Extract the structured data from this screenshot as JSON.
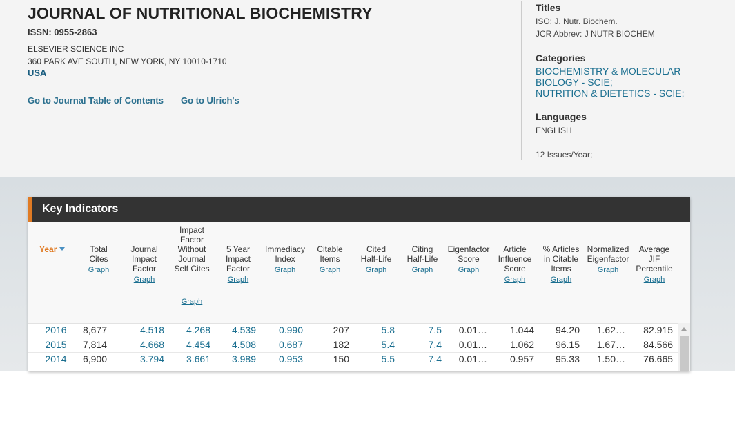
{
  "journal": {
    "title": "JOURNAL OF NUTRITIONAL BIOCHEMISTRY",
    "issn": "ISSN: 0955-2863",
    "publisher": "ELSEVIER SCIENCE INC",
    "address": "360 PARK AVE SOUTH, NEW YORK, NY 10010-1710",
    "country": "USA",
    "links": [
      "Go to Journal Table of Contents",
      "Go to Ulrich's"
    ]
  },
  "sidebar": {
    "titles_heading": "Titles",
    "iso": "ISO: J. Nutr. Biochem.",
    "jcr_abbrev": "JCR Abbrev: J NUTR BIOCHEM",
    "categories_heading": "Categories",
    "categories": [
      "BIOCHEMISTRY & MOLECULAR BIOLOGY - SCIE;",
      "NUTRITION & DIETETICS - SCIE;"
    ],
    "languages_heading": "Languages",
    "language": "ENGLISH",
    "issues": "12 Issues/Year;"
  },
  "key_indicators": {
    "title": "Key Indicators",
    "graph_label": "Graph",
    "year_header": "Year",
    "headers": [
      "Total Cites",
      "Journal Impact Factor",
      "Impact Factor Without Journal Self Cites",
      "5 Year Impact Factor",
      "Immediacy Index",
      "Citable Items",
      "Cited Half-Life",
      "Citing Half-Life",
      "Eigenfactor Score",
      "Article Influence Score",
      "% Articles in Citable Items",
      "Normalized Eigenfactor",
      "Average JIF Percentile"
    ],
    "rows": [
      {
        "year": "2016",
        "values": [
          "8,677",
          "4.518",
          "4.268",
          "4.539",
          "0.990",
          "207",
          "5.8",
          "7.5",
          "0.01…",
          "1.044",
          "94.20",
          "1.62…",
          "82.915"
        ]
      },
      {
        "year": "2015",
        "values": [
          "7,814",
          "4.668",
          "4.454",
          "4.508",
          "0.687",
          "182",
          "5.4",
          "7.4",
          "0.01…",
          "1.062",
          "96.15",
          "1.67…",
          "84.566"
        ]
      },
      {
        "year": "2014",
        "values": [
          "6,900",
          "3.794",
          "3.661",
          "3.989",
          "0.953",
          "150",
          "5.5",
          "7.4",
          "0.01…",
          "0.957",
          "95.33",
          "1.50…",
          "76.665"
        ]
      }
    ]
  },
  "colors": {
    "accent": "#e07b24",
    "link": "#1b6f90",
    "header_bar": "#333333"
  }
}
